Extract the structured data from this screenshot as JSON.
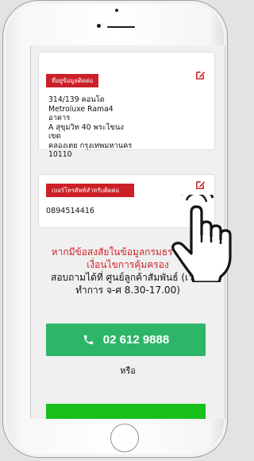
{
  "address": {
    "tag": "ที่อยู่ข้อมูลติดต่อ",
    "lines": [
      "314/139 คอนโด",
      "Metroluxe Rama4 อาคาร",
      "A สุขุมวิท 40 พระโขนง เขต",
      "คลองเตย กรุงเทพมหานคร",
      "10110"
    ]
  },
  "contact_phone": {
    "tag": "เบอร์โทรศัพท์สำหรับติดต่อ",
    "number": "0894514416"
  },
  "info": {
    "red_line1": "หากมีข้อสงสัยในข้อมูลกรมธรรม์ หรือ",
    "red_line2": "เงื่อนไขการคุ้มครอง",
    "black_line1": "สอบถามได้ที่ ศูนย์ลูกค้าสัมพันธ์ (เวลา",
    "black_line2": "ทำการ จ-ศ 8.30-17.00)"
  },
  "call_button": {
    "label": "02 612 9888",
    "icon": "phone-icon"
  },
  "or_label": "หรือ",
  "colors": {
    "red": "#cc2027",
    "green": "#2db667",
    "line_green": "#19c01c"
  }
}
